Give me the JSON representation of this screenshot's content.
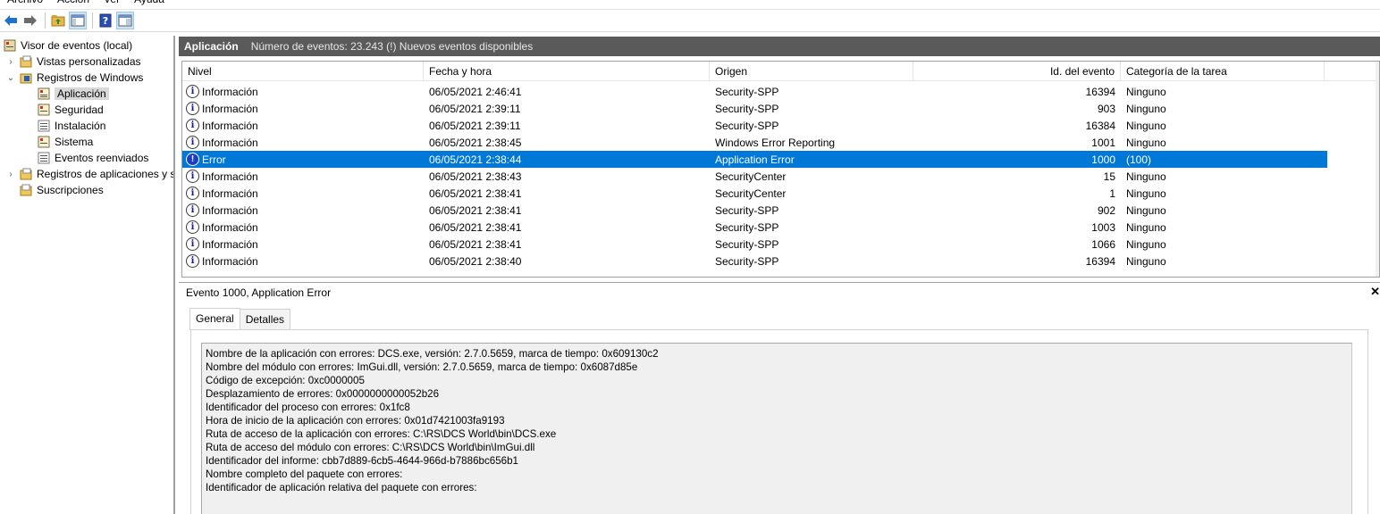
{
  "menu": [
    "Archivo",
    "Acción",
    "Ver",
    "Ayuda"
  ],
  "toolbar": {
    "icons": [
      "back-arrow-icon",
      "forward-arrow-icon",
      "folder-up-icon",
      "show-hide-tree-icon",
      "help-icon",
      "show-hide-action-pane-icon"
    ]
  },
  "tree": {
    "items": [
      {
        "label": "Visor de eventos (local)",
        "level": 0
      },
      {
        "label": "Vistas personalizadas",
        "level": 1
      },
      {
        "label": "Registros de Windows",
        "level": 1
      },
      {
        "label": "Aplicación",
        "level": 2
      },
      {
        "label": "Seguridad",
        "level": 2
      },
      {
        "label": "Instalación",
        "level": 2
      },
      {
        "label": "Sistema",
        "level": 2
      },
      {
        "label": "Eventos reenviados",
        "level": 2
      },
      {
        "label": "Registros de aplicaciones y s",
        "level": 1
      },
      {
        "label": "Suscripciones",
        "level": 1
      }
    ]
  },
  "header": {
    "title": "Aplicación",
    "info": "Número de eventos: 23.243 (!) Nuevos eventos disponibles"
  },
  "grid": {
    "columns": [
      "Nivel",
      "Fecha y hora",
      "Origen",
      "Id. del evento",
      "Categoría de la tarea"
    ],
    "rows": [
      {
        "nivel": "Información",
        "fecha": "06/05/2021 2:46:41",
        "origen": "Security-SPP",
        "id": "16394",
        "cat": "Ninguno"
      },
      {
        "nivel": "Información",
        "fecha": "06/05/2021 2:39:11",
        "origen": "Security-SPP",
        "id": "903",
        "cat": "Ninguno"
      },
      {
        "nivel": "Información",
        "fecha": "06/05/2021 2:39:11",
        "origen": "Security-SPP",
        "id": "16384",
        "cat": "Ninguno"
      },
      {
        "nivel": "Información",
        "fecha": "06/05/2021 2:38:45",
        "origen": "Windows Error Reporting",
        "id": "1001",
        "cat": "Ninguno"
      },
      {
        "nivel": "Error",
        "fecha": "06/05/2021 2:38:44",
        "origen": "Application Error",
        "id": "1000",
        "cat": "(100)"
      },
      {
        "nivel": "Información",
        "fecha": "06/05/2021 2:38:43",
        "origen": "SecurityCenter",
        "id": "15",
        "cat": "Ninguno"
      },
      {
        "nivel": "Información",
        "fecha": "06/05/2021 2:38:41",
        "origen": "SecurityCenter",
        "id": "1",
        "cat": "Ninguno"
      },
      {
        "nivel": "Información",
        "fecha": "06/05/2021 2:38:41",
        "origen": "Security-SPP",
        "id": "902",
        "cat": "Ninguno"
      },
      {
        "nivel": "Información",
        "fecha": "06/05/2021 2:38:41",
        "origen": "Security-SPP",
        "id": "1003",
        "cat": "Ninguno"
      },
      {
        "nivel": "Información",
        "fecha": "06/05/2021 2:38:41",
        "origen": "Security-SPP",
        "id": "1066",
        "cat": "Ninguno"
      },
      {
        "nivel": "Información",
        "fecha": "06/05/2021 2:38:40",
        "origen": "Security-SPP",
        "id": "16394",
        "cat": "Ninguno"
      }
    ],
    "selected_index": 4
  },
  "detail": {
    "title": "Evento 1000, Application Error",
    "tabs": [
      "General",
      "Detalles"
    ],
    "lines": [
      "Nombre de la aplicación con errores: DCS.exe, versión: 2.7.0.5659, marca de tiempo: 0x609130c2",
      "Nombre del módulo con errores: ImGui.dll, versión: 2.7.0.5659, marca de tiempo: 0x6087d85e",
      "Código de excepción: 0xc0000005",
      "Desplazamiento de errores: 0x0000000000052b26",
      "Identificador del proceso con errores: 0x1fc8",
      "Hora de inicio de la aplicación con errores: 0x01d7421003fa9193",
      "Ruta de acceso de la aplicación con errores: C:\\RS\\DCS World\\bin\\DCS.exe",
      "Ruta de acceso del módulo con errores: C:\\RS\\DCS World\\bin\\ImGui.dll",
      "Identificador del informe: cbb7d889-6cb5-4644-966d-b7886bc656b1",
      "Nombre completo del paquete con errores:",
      "Identificador de aplicación relativa del paquete con errores:"
    ]
  },
  "colors": {
    "selection": "#0078d7",
    "header_bar": "#5a5a5a"
  }
}
